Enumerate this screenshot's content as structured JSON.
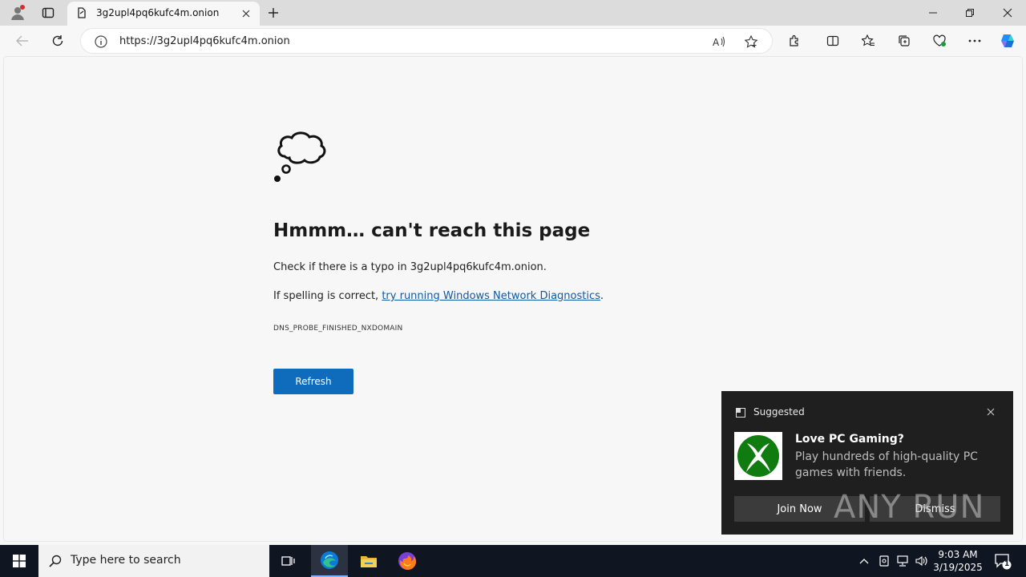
{
  "browser": {
    "tab_title": "3g2upl4pq6kufc4m.onion",
    "url": "https://3g2upl4pq6kufc4m.onion"
  },
  "error_page": {
    "title": "Hmmm… can't reach this page",
    "line1": "Check if there is a typo in 3g2upl4pq6kufc4m.onion.",
    "line2_prefix": "If spelling is correct, ",
    "line2_link": "try running Windows Network Diagnostics",
    "line2_suffix": ".",
    "error_code": "DNS_PROBE_FINISHED_NXDOMAIN",
    "refresh_label": "Refresh"
  },
  "notification": {
    "header": "Suggested",
    "title": "Love PC Gaming?",
    "body": "Play hundreds of high-quality PC games with friends.",
    "primary_button": "Join Now",
    "secondary_button": "Dismiss"
  },
  "watermark": "ANY RUN",
  "taskbar": {
    "search_placeholder": "Type here to search",
    "time": "9:03 AM",
    "date": "3/19/2025",
    "notification_count": "1"
  },
  "colors": {
    "accent": "#0f6cbd",
    "link": "#0f5aa6",
    "taskbar": "#101522",
    "toast_bg": "#1f1f1f",
    "xbox_green": "#107c10"
  }
}
